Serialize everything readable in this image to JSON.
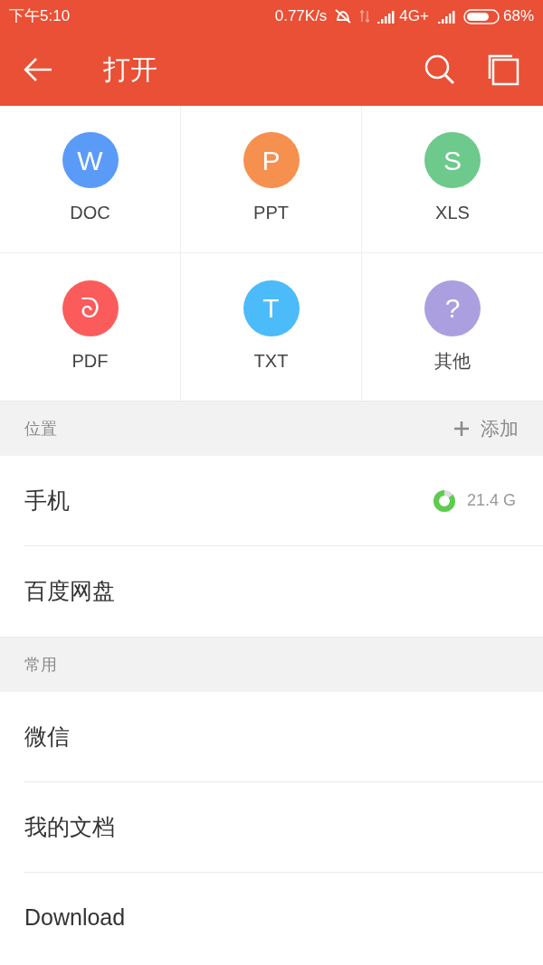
{
  "status_bar": {
    "time": "下午5:10",
    "speed": "0.77K/s",
    "network": "4G+",
    "battery": "68%"
  },
  "app_bar": {
    "title": "打开"
  },
  "file_types": [
    {
      "glyph": "W",
      "label": "DOC",
      "color": "#5b9bf8"
    },
    {
      "glyph": "P",
      "label": "PPT",
      "color": "#f6904e"
    },
    {
      "glyph": "S",
      "label": "XLS",
      "color": "#6dc98c"
    },
    {
      "glyph": "ᘐ",
      "label": "PDF",
      "color": "#fb5b5b"
    },
    {
      "glyph": "T",
      "label": "TXT",
      "color": "#4bbbfa"
    },
    {
      "glyph": "?",
      "label": "其他",
      "color": "#ab9fe0"
    }
  ],
  "sections": [
    {
      "title": "位置",
      "action": "添加",
      "items": [
        {
          "label": "手机",
          "storage": {
            "level": 0.85,
            "reading": "21.4 G"
          }
        },
        {
          "label": "百度网盘"
        }
      ]
    },
    {
      "title": "常用",
      "items": [
        {
          "label": "微信"
        },
        {
          "label": "我的文档"
        },
        {
          "label": "Download"
        }
      ]
    }
  ]
}
